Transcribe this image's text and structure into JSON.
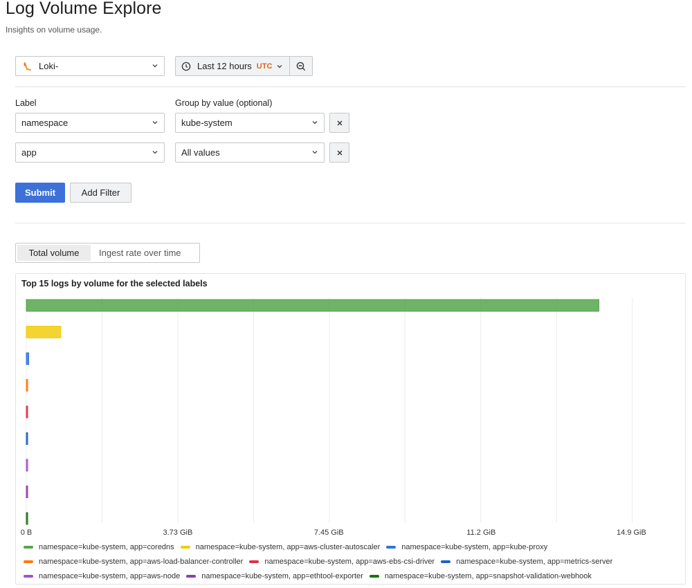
{
  "header": {
    "title": "Log Volume Explore",
    "subtitle": "Insights on volume usage."
  },
  "toolbar": {
    "datasource": "Loki-",
    "time_range": "Last 12 hours",
    "timezone": "UTC"
  },
  "filters": {
    "label_heading": "Label",
    "group_heading": "Group by value (optional)",
    "rows": [
      {
        "label": "namespace",
        "value": "kube-system"
      },
      {
        "label": "app",
        "value": "All values"
      }
    ]
  },
  "actions": {
    "submit_label": "Submit",
    "add_filter_label": "Add Filter"
  },
  "tabs": [
    {
      "label": "Total volume",
      "active": true
    },
    {
      "label": "Ingest rate over time",
      "active": false
    }
  ],
  "chart_data": {
    "type": "bar",
    "orientation": "horizontal",
    "title": "Top 15 logs by volume for the selected labels",
    "x_tick_labels": [
      "0 B",
      "3.73 GiB",
      "7.45 GiB",
      "11.2 GiB",
      "14.9 GiB"
    ],
    "x_ticks_gib": [
      0,
      3.73,
      7.45,
      11.2,
      14.9
    ],
    "xlim_gib": [
      0,
      16.0
    ],
    "unit": "GiB",
    "grid": true,
    "legend_placement": "bottom",
    "series": [
      {
        "name": "namespace=kube-system, app=coredns",
        "value": 14.1,
        "color": "#56a64b"
      },
      {
        "name": "namespace=kube-system, app=aws-cluster-autoscaler",
        "value": 0.85,
        "color": "#f2cc0c"
      },
      {
        "name": "namespace=kube-system, app=kube-proxy",
        "value": 0.06,
        "color": "#3274d9"
      },
      {
        "name": "namespace=kube-system, app=aws-load-balancer-controller",
        "value": 0.02,
        "color": "#ff780a"
      },
      {
        "name": "namespace=kube-system, app=aws-ebs-csi-driver",
        "value": 0.02,
        "color": "#e02f44"
      },
      {
        "name": "namespace=kube-system, app=metrics-server",
        "value": 0.02,
        "color": "#1f60c4"
      },
      {
        "name": "namespace=kube-system, app=aws-node",
        "value": 0.02,
        "color": "#a352cc"
      },
      {
        "name": "namespace=kube-system, app=ethtool-exporter",
        "value": 0.02,
        "color": "#8f3bb8"
      },
      {
        "name": "namespace=kube-system, app=snapshot-validation-webhook",
        "value": 0.02,
        "color": "#19730e"
      }
    ]
  }
}
